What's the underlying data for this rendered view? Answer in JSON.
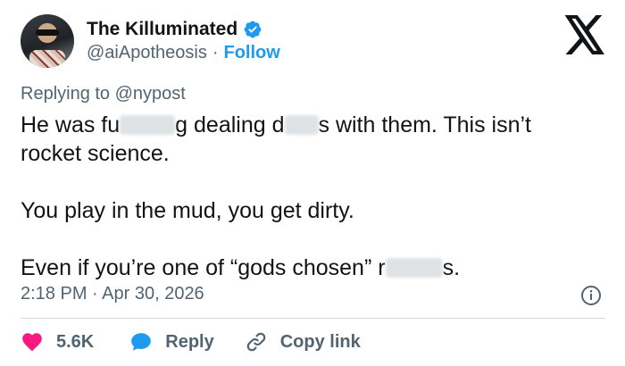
{
  "author": {
    "display_name": "The Killuminated",
    "handle": "@aiApotheosis",
    "separator": "·",
    "follow_label": "Follow"
  },
  "reply_context": {
    "prefix": "Replying to",
    "mention": "@nypost"
  },
  "tweet": {
    "line1_a": "He was fu",
    "line1_b": "g dealing d",
    "line1_c": "s with them. This isn’t",
    "line2": "rocket science.",
    "line3": "You play in the mud, you get dirty.",
    "line4_a": "Even if you’re one of “gods chosen” r",
    "line4_b": "s."
  },
  "timestamp": "2:18 PM · Apr 30, 2026",
  "actions": {
    "like_count": "5.6K",
    "reply_label": "Reply",
    "copy_label": "Copy link"
  },
  "colors": {
    "accent": "#1d9bf0",
    "like": "#f91880",
    "muted": "#536471"
  }
}
